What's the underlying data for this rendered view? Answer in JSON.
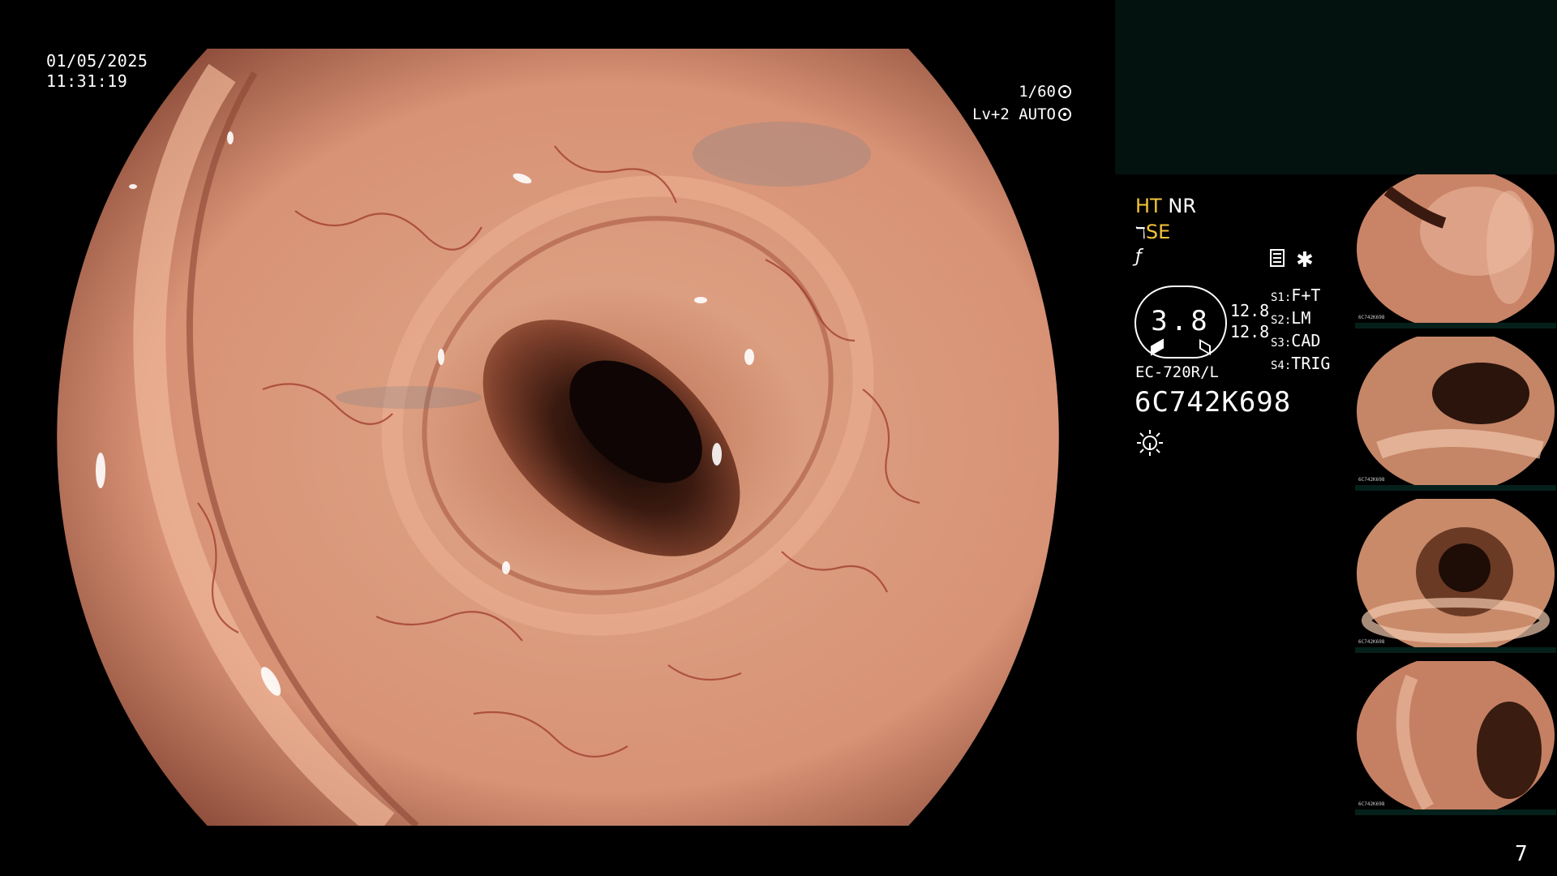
{
  "overlay": {
    "date": "01/05/2025",
    "time": "11:31:19",
    "shutter_speed": "1/60",
    "level": "Lv+2 AUTO"
  },
  "panel": {
    "ht": "HT",
    "nr": "NR",
    "se": "SE",
    "gauge_value": "3.8",
    "gauge_num_1": "12.8",
    "gauge_num_2": "12.8",
    "scope_settings": [
      {
        "key": "S1:",
        "value": "F+T"
      },
      {
        "key": "S2:",
        "value": "LM"
      },
      {
        "key": "S3:",
        "value": "CAD"
      },
      {
        "key": "S4:",
        "value": "TRIG"
      }
    ],
    "model": "EC-720R/L",
    "serial": "6C742K698"
  },
  "thumbnails": [
    {
      "label": "6C742K698"
    },
    {
      "label": "6C742K698"
    },
    {
      "label": "6C742K698"
    },
    {
      "label": "6C742K698"
    }
  ],
  "page_number": "7",
  "colors": {
    "tissue": "#d89a7a",
    "vessel": "#9e3a2a",
    "lumen": "#1e0e08",
    "accent_yellow": "#f3c43a",
    "panel_dark": "#03120f"
  }
}
